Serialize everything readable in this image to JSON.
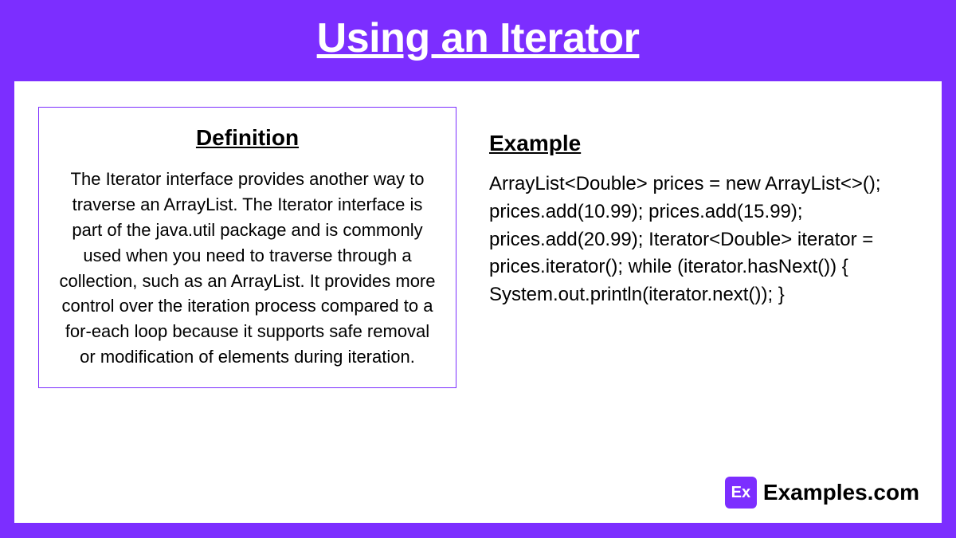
{
  "header": {
    "title": "Using an Iterator"
  },
  "definition": {
    "heading": "Definition",
    "text": "The Iterator interface provides another way to traverse an ArrayList. The Iterator interface is part of the java.util package and is commonly used when you need to traverse through a collection, such as an ArrayList. It provides more control over the iteration process compared to a for-each loop because it supports safe removal or modification of elements during iteration."
  },
  "example": {
    "heading": "Example",
    "code": "ArrayList<Double> prices = new ArrayList<>(); prices.add(10.99); prices.add(15.99); prices.add(20.99); Iterator<Double> iterator = prices.iterator(); while (iterator.hasNext()) { System.out.println(iterator.next()); }"
  },
  "footer": {
    "logo_short": "Ex",
    "logo_text": "Examples.com"
  }
}
